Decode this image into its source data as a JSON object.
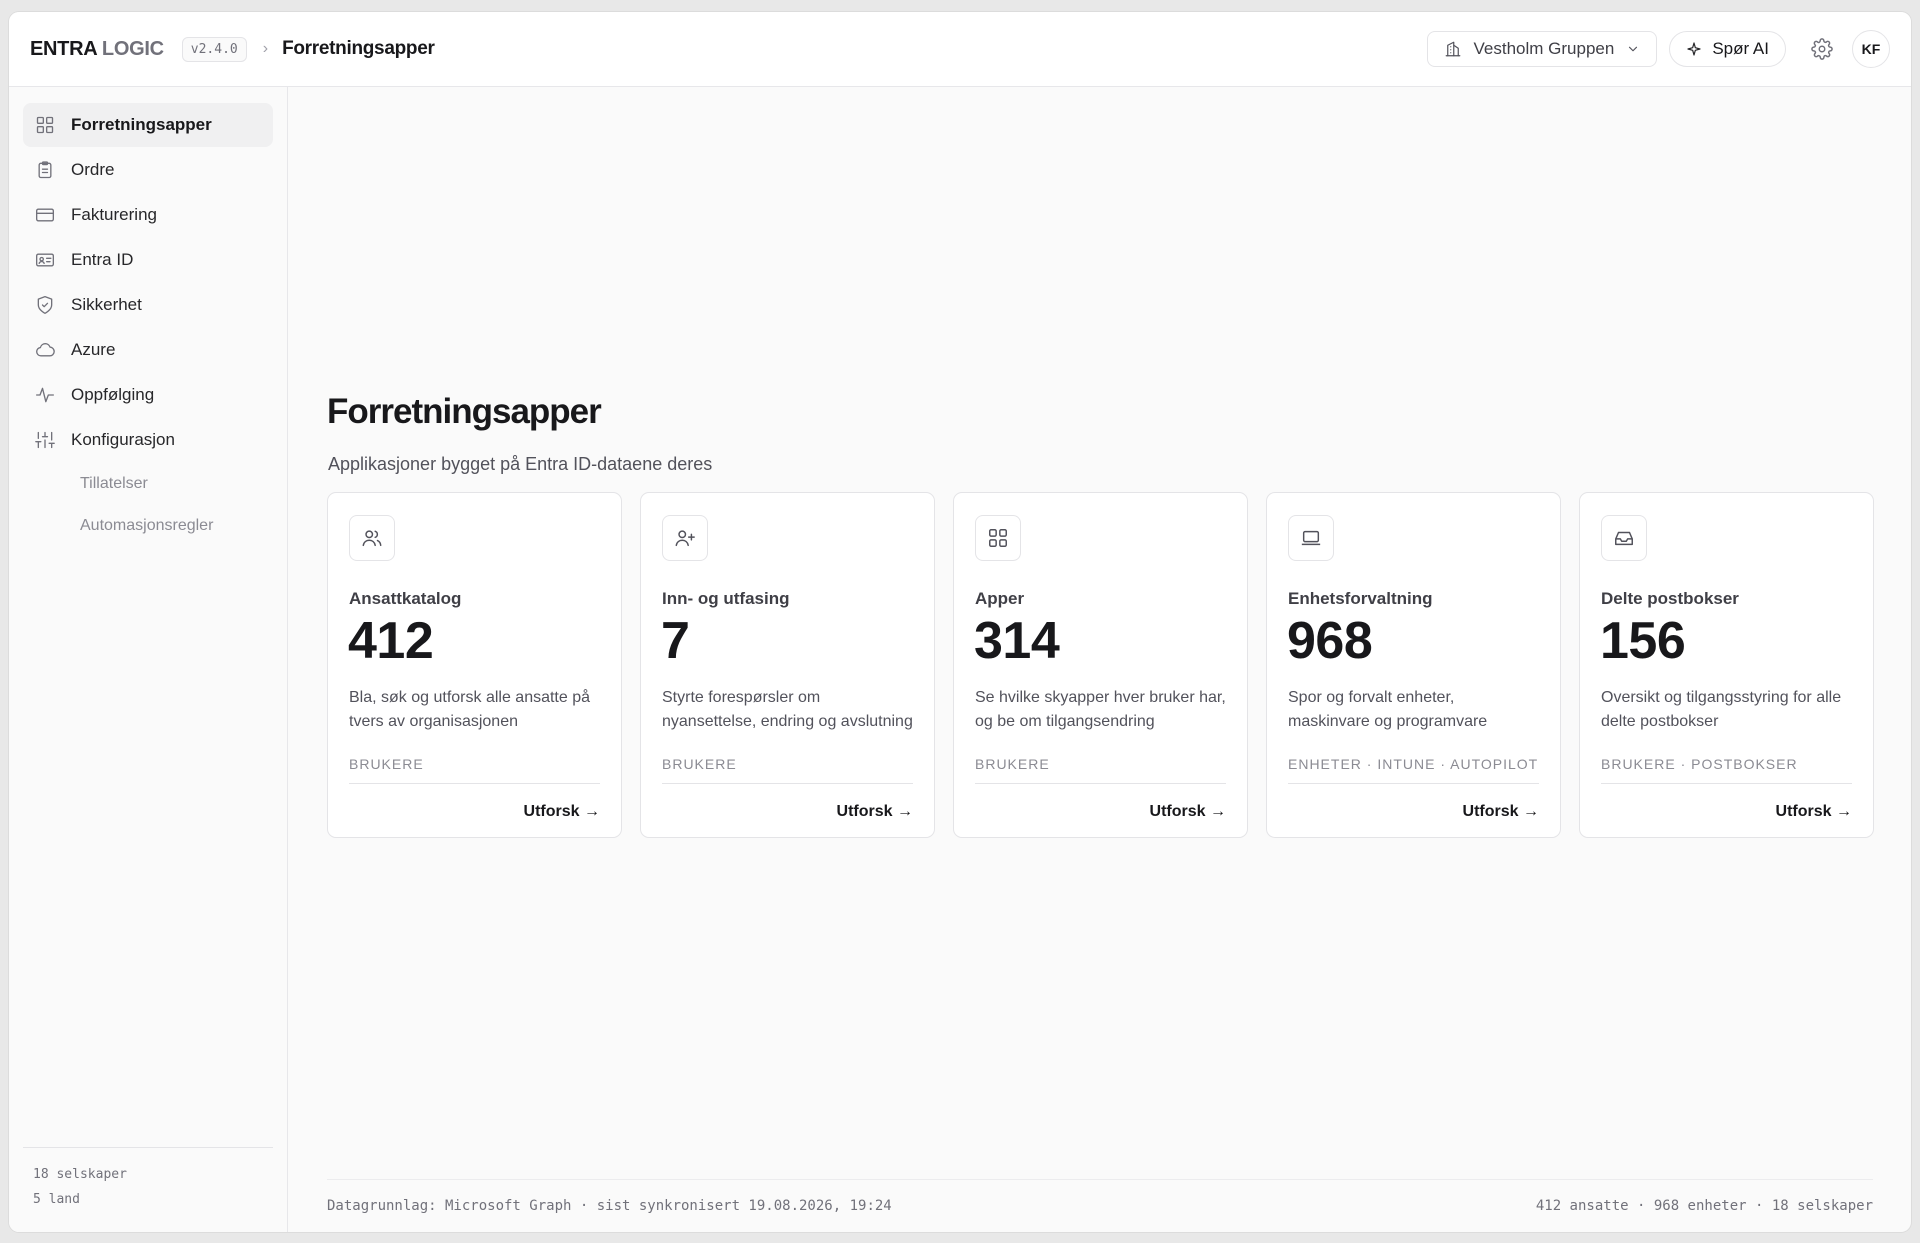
{
  "header": {
    "brand_primary": "ENTRA",
    "brand_secondary": "LOGIC",
    "version": "v2.4.0",
    "breadcrumb_sep": "›",
    "breadcrumb_current": "Forretningsapper",
    "org_selector": "Vestholm Gruppen",
    "ai_button": "Spør AI",
    "avatar_initials": "KF"
  },
  "sidebar": {
    "items": [
      {
        "label": "Forretningsapper",
        "icon": "grid-icon",
        "active": true
      },
      {
        "label": "Ordre",
        "icon": "clipboard-icon"
      },
      {
        "label": "Fakturering",
        "icon": "credit-card-icon"
      },
      {
        "label": "Entra ID",
        "icon": "id-card-icon"
      },
      {
        "label": "Sikkerhet",
        "icon": "shield-check-icon"
      },
      {
        "label": "Azure",
        "icon": "cloud-icon"
      },
      {
        "label": "Oppfølging",
        "icon": "activity-icon"
      },
      {
        "label": "Konfigurasjon",
        "icon": "sliders-icon"
      }
    ],
    "sub_items": [
      "Tillatelser",
      "Automasjonsregler"
    ],
    "footer": {
      "companies": "18 selskaper",
      "countries": "5 land"
    }
  },
  "main": {
    "title": "Forretningsapper",
    "subtitle": "Applikasjoner bygget på Entra ID-dataene deres",
    "cards": [
      {
        "title": "Ansattkatalog",
        "count": "412",
        "desc": "Bla, søk og utforsk alle ansatte på tvers av organisasjonen",
        "tags": "BRUKERE",
        "link": "Utforsk →",
        "icon": "users-icon"
      },
      {
        "title": "Inn- og utfasing",
        "count": "7",
        "desc": "Styrte forespørsler om nyansettelse, endring og avslutning",
        "tags": "BRUKERE",
        "link": "Utforsk →",
        "icon": "user-plus-icon"
      },
      {
        "title": "Apper",
        "count": "314",
        "desc": "Se hvilke skyapper hver bruker har, og be om tilgangsendring",
        "tags": "BRUKERE",
        "link": "Utforsk →",
        "icon": "apps-grid-icon"
      },
      {
        "title": "Enhetsforvaltning",
        "count": "968",
        "desc": "Spor og forvalt enheter, maskinvare og programvare",
        "tags": "ENHETER · INTUNE · AUTOPILOT",
        "link": "Utforsk →",
        "icon": "laptop-icon"
      },
      {
        "title": "Delte postbokser",
        "count": "156",
        "desc": "Oversikt og tilgangsstyring for alle delte postbokser",
        "tags": "BRUKERE · POSTBOKSER",
        "link": "Utforsk →",
        "icon": "inbox-icon"
      }
    ],
    "footer": {
      "left": "Datagrunnlag: Microsoft Graph · sist synkronisert 19.08.2026, 19:24",
      "right": "412 ansatte · 968 enheter · 18 selskaper"
    }
  }
}
